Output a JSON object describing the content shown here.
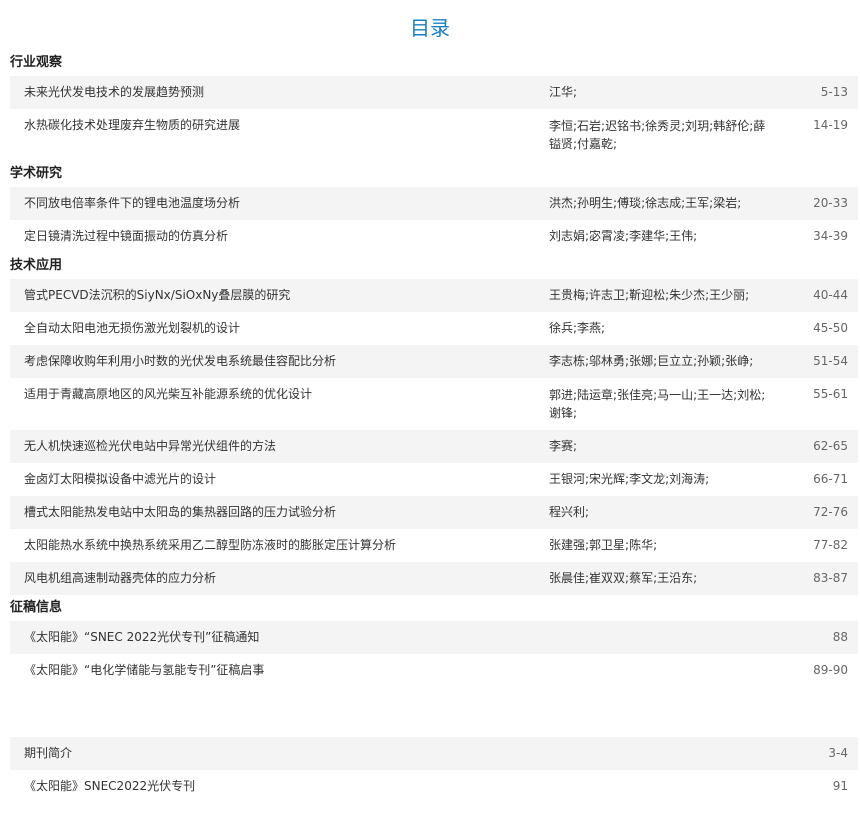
{
  "title": "目录",
  "sections": [
    {
      "name": "行业观察",
      "items": [
        {
          "title": "未来光伏发电技术的发展趋势预测",
          "authors": "江华;",
          "pages": "5-13"
        },
        {
          "title": "水热碳化技术处理废弃生物质的研究进展",
          "authors": "李恒;石岩;迟铭书;徐秀灵;刘玥;韩舒伦;薛镒贤;付嘉乾;",
          "pages": "14-19"
        }
      ]
    },
    {
      "name": "学术研究",
      "items": [
        {
          "title": "不同放电倍率条件下的锂电池温度场分析",
          "authors": "洪杰;孙明生;傅琰;徐志成;王军;梁岩;",
          "pages": "20-33"
        },
        {
          "title": "定日镜清洗过程中镜面振动的仿真分析",
          "authors": "刘志娟;宓霄凌;李建华;王伟;",
          "pages": "34-39"
        }
      ]
    },
    {
      "name": "技术应用",
      "items": [
        {
          "title": "管式PECVD法沉积的SiyNx/SiOxNy叠层膜的研究",
          "authors": "王贵梅;许志卫;靳迎松;朱少杰;王少丽;",
          "pages": "40-44"
        },
        {
          "title": "全自动太阳电池无损伤激光划裂机的设计",
          "authors": "徐兵;李燕;",
          "pages": "45-50"
        },
        {
          "title": "考虑保障收购年利用小时数的光伏发电系统最佳容配比分析",
          "authors": "李志栋;邬林勇;张娜;巨立立;孙颖;张峥;",
          "pages": "51-54"
        },
        {
          "title": "适用于青藏高原地区的风光柴互补能源系统的优化设计",
          "authors": "郭进;陆运章;张佳亮;马一山;王一达;刘松;谢锋;",
          "pages": "55-61"
        },
        {
          "title": "无人机快速巡检光伏电站中异常光伏组件的方法",
          "authors": "李赛;",
          "pages": "62-65"
        },
        {
          "title": "金卤灯太阳模拟设备中滤光片的设计",
          "authors": "王银河;宋光辉;李文龙;刘海涛;",
          "pages": "66-71"
        },
        {
          "title": "槽式太阳能热发电站中太阳岛的集热器回路的压力试验分析",
          "authors": "程兴利;",
          "pages": "72-76"
        },
        {
          "title": "太阳能热水系统中换热系统采用乙二醇型防冻液时的膨胀定压计算分析",
          "authors": "张建强;郭卫星;陈华;",
          "pages": "77-82"
        },
        {
          "title": "风电机组高速制动器壳体的应力分析",
          "authors": "张晨佳;崔双双;蔡军;王沿东;",
          "pages": "83-87"
        }
      ]
    },
    {
      "name": "征稿信息",
      "items": [
        {
          "title": "《太阳能》“SNEC 2022光伏专刊”征稿通知",
          "authors": "",
          "pages": "88"
        },
        {
          "title": "《太阳能》“电化学储能与氢能专刊”征稿启事",
          "authors": "",
          "pages": "89-90"
        }
      ]
    }
  ],
  "extra": [
    {
      "title": "期刊简介",
      "pages": "3-4"
    },
    {
      "title": "《太阳能》SNEC2022光伏专刊",
      "pages": "91"
    }
  ]
}
